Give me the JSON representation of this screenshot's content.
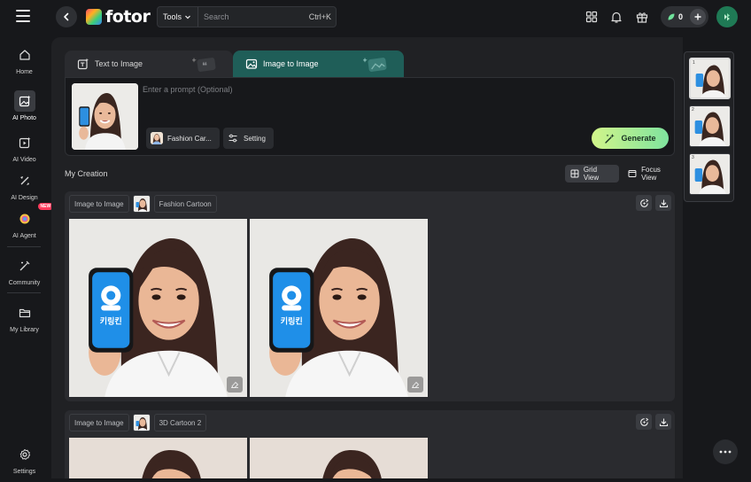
{
  "app": {
    "brand": "fotor",
    "colors": {
      "accent": "#1f5e58",
      "generate": "#a8ee93",
      "avatar": "#1f7a55",
      "badge": "#ff3b5c"
    }
  },
  "topbar": {
    "tools_label": "Tools",
    "search_placeholder": "Search",
    "shortcut": "Ctrl+K",
    "credits": "0",
    "icons": [
      "grid-icon",
      "bell-icon",
      "gift-icon",
      "leaf-icon",
      "plus-icon",
      "user-avatar-icon"
    ]
  },
  "sidebar": {
    "items": [
      {
        "label": "Home",
        "icon": "home-icon"
      },
      {
        "label": "AI Photo",
        "icon": "ai-photo-icon",
        "active": true
      },
      {
        "label": "AI Video",
        "icon": "ai-video-icon"
      },
      {
        "label": "AI Design",
        "icon": "ai-design-icon"
      },
      {
        "label": "AI Agent",
        "icon": "ai-agent-icon",
        "badge": "NEW"
      },
      {
        "label": "Community",
        "icon": "community-icon"
      },
      {
        "label": "My Library",
        "icon": "folder-icon"
      },
      {
        "label": "Settings",
        "icon": "gear-icon"
      }
    ]
  },
  "tabs": [
    {
      "label": "Text to Image",
      "active": false
    },
    {
      "label": "Image to Image",
      "active": true
    }
  ],
  "prompt": {
    "placeholder": "Enter a prompt (Optional)",
    "style_chip": "Fashion Car...",
    "setting_chip": "Setting",
    "generate_label": "Generate"
  },
  "creation": {
    "title": "My Creation",
    "views": [
      {
        "label": "Grid View",
        "active": true
      },
      {
        "label": "Focus View",
        "active": false
      }
    ],
    "cards": [
      {
        "mode": "Image to Image",
        "style": "Fashion Cartoon"
      },
      {
        "mode": "Image to Image",
        "style": "3D Cartoon 2"
      }
    ]
  },
  "history_rail": {
    "items": [
      "1",
      "2",
      "3"
    ]
  },
  "result_image": {
    "phone_text": "키링킨"
  }
}
